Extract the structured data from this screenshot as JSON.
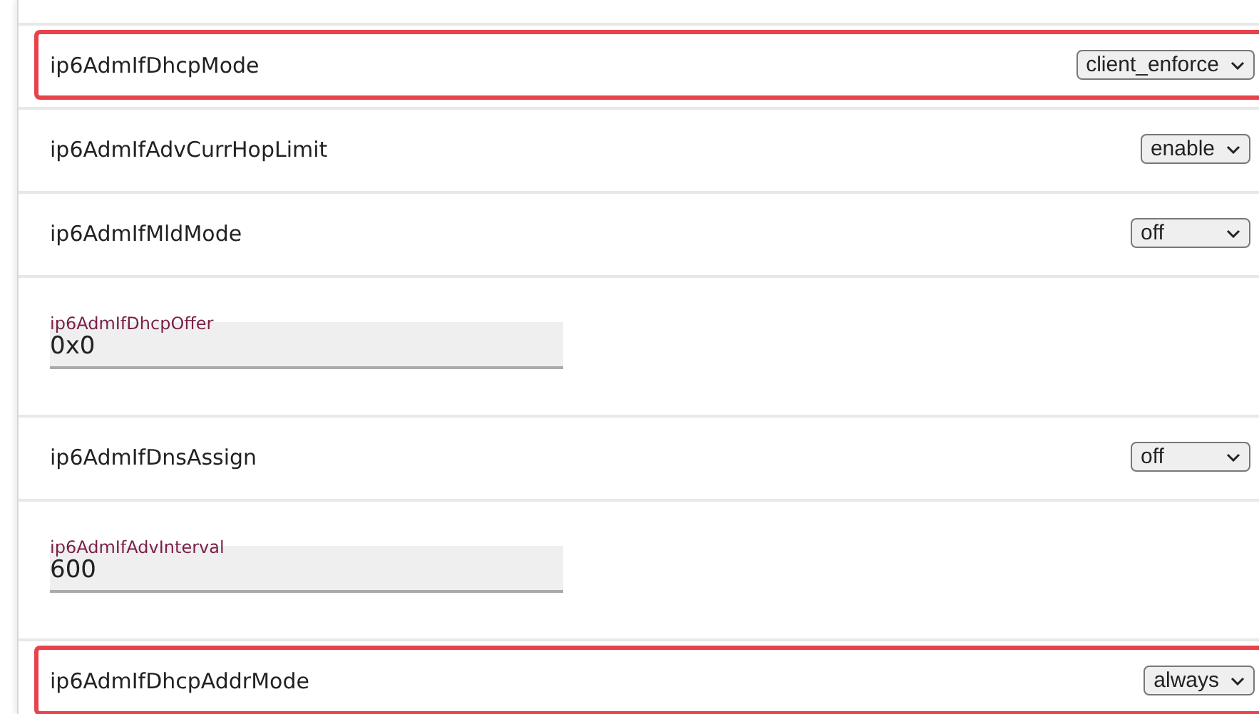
{
  "rows": [
    {
      "kind": "select",
      "label": "ip6AdmIfDhcpMode",
      "value": "client_enforce",
      "highlighted": true
    },
    {
      "kind": "select",
      "label": "ip6AdmIfAdvCurrHopLimit",
      "value": "enable",
      "highlighted": false
    },
    {
      "kind": "select",
      "label": "ip6AdmIfMldMode",
      "value": "off",
      "highlighted": false
    },
    {
      "kind": "input",
      "label": "ip6AdmIfDhcpOffer",
      "value": "0x0",
      "highlighted": false
    },
    {
      "kind": "select",
      "label": "ip6AdmIfDnsAssign",
      "value": "off",
      "highlighted": false
    },
    {
      "kind": "input",
      "label": "ip6AdmIfAdvInterval",
      "value": "600",
      "highlighted": false
    },
    {
      "kind": "select",
      "label": "ip6AdmIfDhcpAddrMode",
      "value": "always",
      "highlighted": true
    }
  ]
}
